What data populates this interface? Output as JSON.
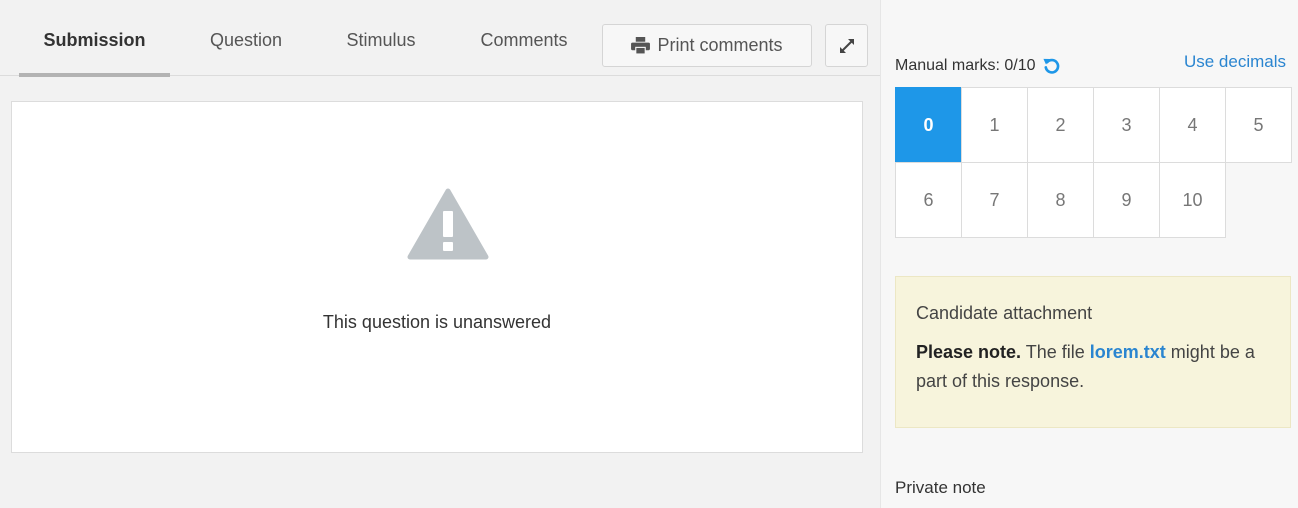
{
  "tabs": {
    "submission": "Submission",
    "question": "Question",
    "stimulus": "Stimulus",
    "comments": "Comments"
  },
  "toolbar": {
    "print_label": "Print comments",
    "print_icon": "printer-icon",
    "expand_icon": "expand-icon"
  },
  "content": {
    "status_icon": "warning-icon",
    "status_text": "This question is unanswered"
  },
  "marks": {
    "label": "Manual marks: 0/10",
    "reset_icon": "undo-icon",
    "decimals_link": "Use decimals",
    "selected": "0",
    "options": [
      "0",
      "1",
      "2",
      "3",
      "4",
      "5",
      "6",
      "7",
      "8",
      "9",
      "10"
    ]
  },
  "attachment": {
    "title": "Candidate attachment",
    "note_bold": "Please note.",
    "note_pre": " The file ",
    "file_name": "lorem.txt",
    "note_post": " might be a part of this response."
  },
  "private_note": {
    "label": "Private note"
  },
  "colors": {
    "accent": "#1e97e8",
    "link": "#2a85d0",
    "notice_bg": "#f7f4dc"
  }
}
